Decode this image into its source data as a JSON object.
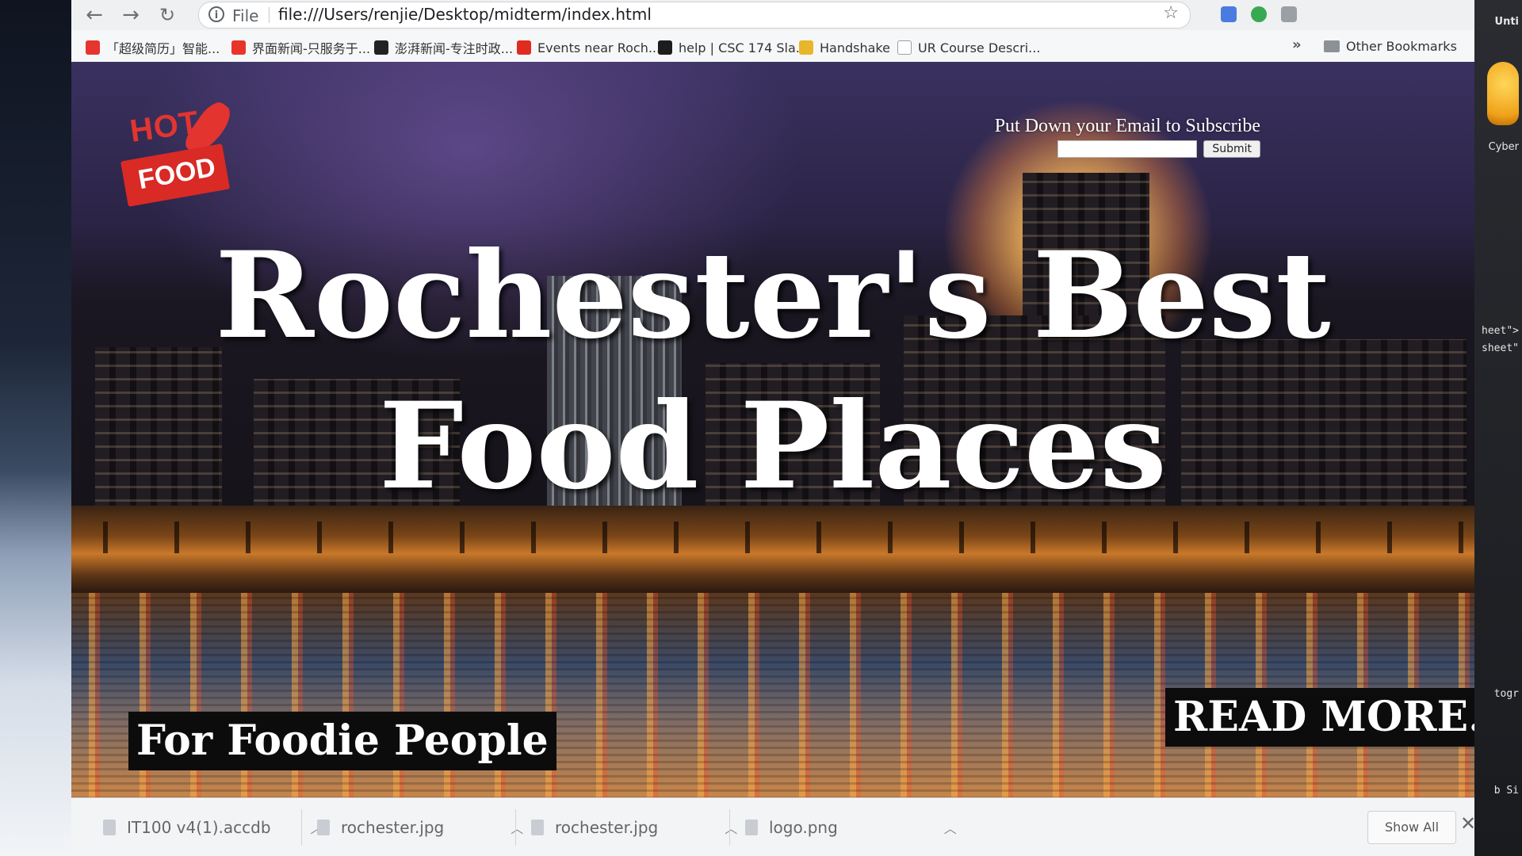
{
  "browser": {
    "file_label": "File",
    "url": "file:///Users/renjie/Desktop/midterm/index.html"
  },
  "bookmarks": {
    "items": [
      {
        "label": "「超级简历」智能...",
        "icon": "resume-icon",
        "color": "#e5352e"
      },
      {
        "label": "界面新闻-只服务于...",
        "icon": "jiemian-icon",
        "color": "#e8342b"
      },
      {
        "label": "澎湃新闻-专注时政...",
        "icon": "thepaper-icon",
        "color": "#222222"
      },
      {
        "label": "Events near Roch...",
        "icon": "meetup-icon",
        "color": "#e02b20"
      },
      {
        "label": "help | CSC 174 Sla...",
        "icon": "slack-icon",
        "color": "#1d1d1d"
      },
      {
        "label": "Handshake",
        "icon": "handshake-icon",
        "color": "#e8b62a"
      },
      {
        "label": "UR Course Descri...",
        "icon": "page-icon",
        "color": "#9aa0a6"
      }
    ],
    "more": "»",
    "other": "Other Bookmarks"
  },
  "page": {
    "logo": {
      "hot": "HOT",
      "food": "FOOD"
    },
    "subscribe": {
      "label": "Put Down your Email to Subscribe",
      "button": "Submit",
      "email_value": ""
    },
    "headline": "Rochester's Best Food Places",
    "tagline": "For Foodie People",
    "read_more": "READ MORE..."
  },
  "downloads": {
    "items": [
      {
        "name": "IT100 v4(1).accdb"
      },
      {
        "name": "rochester.jpg"
      },
      {
        "name": "rochester.jpg"
      },
      {
        "name": "logo.png"
      }
    ],
    "show_all": "Show All",
    "close": "✕"
  },
  "right_edge": {
    "title": "Unti",
    "label": "Cyber",
    "code1": "heet\">",
    "code2": "sheet\"",
    "code3": "togr",
    "code4": "b Si"
  }
}
